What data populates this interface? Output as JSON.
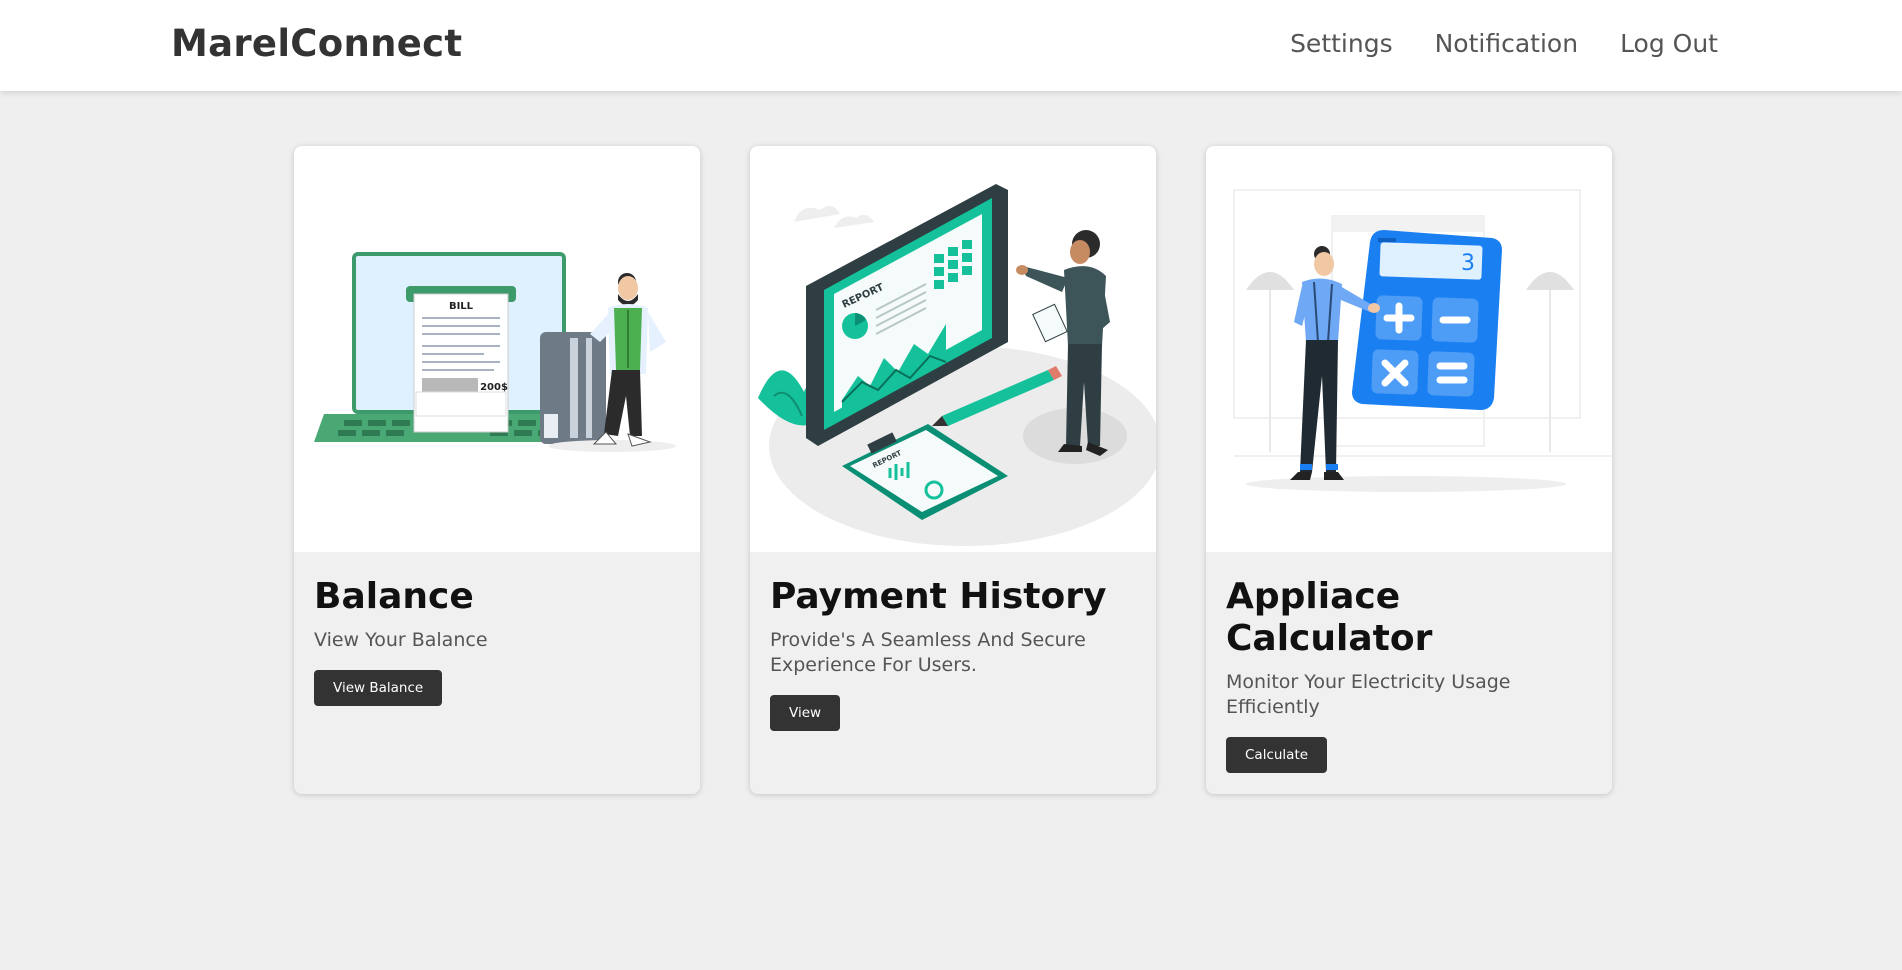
{
  "header": {
    "brand": "MarelConnect",
    "nav": [
      {
        "label": "Settings"
      },
      {
        "label": "Notification"
      },
      {
        "label": "Log Out"
      }
    ]
  },
  "cards": [
    {
      "title": "Balance",
      "description": "View Your Balance",
      "button": "View Balance",
      "illustration": "bill-laptop-illustration",
      "illustration_text": [
        "BILL",
        "200$"
      ]
    },
    {
      "title": "Payment History",
      "description": "Provide's A Seamless And Secure Experience For Users.",
      "button": "View",
      "illustration": "report-tablet-illustration",
      "illustration_text": [
        "REPORT",
        "REPORT"
      ]
    },
    {
      "title": "Appliace Calculator",
      "description": "Monitor Your Electricity Usage Efficiently",
      "button": "Calculate",
      "illustration": "calculator-illustration",
      "illustration_text": [
        "3"
      ]
    }
  ],
  "colors": {
    "green": "#3d9a6a",
    "teal": "#14c19a",
    "blue": "#1a7ff0",
    "dark_button": "#333333"
  }
}
